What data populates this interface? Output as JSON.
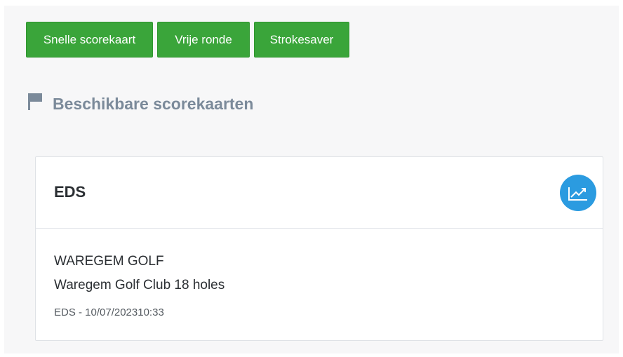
{
  "actions": {
    "quick_scorecard_label": "Snelle scorekaart",
    "free_round_label": "Vrije ronde",
    "strokesaver_label": "Strokesaver"
  },
  "section": {
    "title": "Beschikbare scorekaarten",
    "icon": "flag-icon"
  },
  "card": {
    "title": "EDS",
    "stats_icon": "chart-line-icon",
    "club_name": "WAREGEM GOLF",
    "course_name": "Waregem Golf Club 18 holes",
    "meta": "EDS - 10/07/202310:33"
  },
  "colors": {
    "primary_green": "#3aa53a",
    "accent_blue": "#2b9be0",
    "section_title": "#7b8a9a"
  }
}
